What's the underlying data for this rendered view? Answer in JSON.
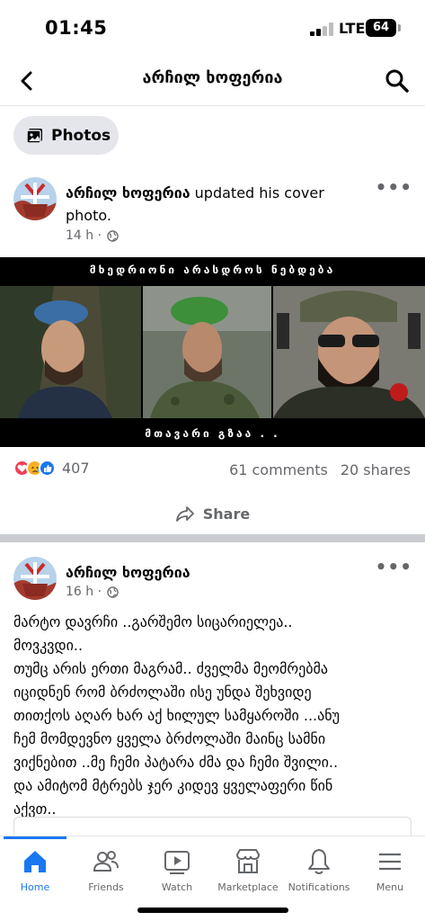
{
  "status_bar": {
    "time": "01:45",
    "network": "LTE",
    "battery": "64"
  },
  "header": {
    "title": "არჩილ ხოფერია"
  },
  "filter_chip": {
    "label": "Photos",
    "icon": "photos-icon"
  },
  "post1": {
    "author": "არჩილ ხოფერია",
    "action": " updated his cover photo.",
    "time": "14 h",
    "cover_image": {
      "top_text": "მხედრიონი არასდროს ნებდება",
      "bottom_text": "მთავარი გზაა . ."
    },
    "reactions": [
      "love",
      "sad",
      "like"
    ],
    "reaction_count": "407",
    "comments": "61 comments",
    "shares": "20 shares",
    "share_label": "Share"
  },
  "post2": {
    "author": "არჩილ ხოფერია",
    "time": "16 h",
    "text_lines": [
      "მარტო დავრჩი ..გარშემო სიცარიელეა..",
      "მოვკვდი..",
      "თუმც არის ერთი მაგრამ.. ძველმა მეომრებმა",
      "იციდნენ რომ ბრძოლაში ისე  უნდა შეხვიდე",
      "თითქოს აღარ ხარ აქ ხილულ სამყაროში ...ანუ",
      "ჩემ მომდევნო ყველა ბრძოლაში მაინც სამნი",
      "ვიქნებით ..მე ჩემი პატარა ძმა და ჩემი შვილი..",
      "და ამიტომ მტრებს ჯერ კიდევ ყველაფერი წინ",
      "აქვთ.."
    ]
  },
  "bottom_nav": [
    {
      "label": "Home",
      "icon": "home-icon",
      "active": true
    },
    {
      "label": "Friends",
      "icon": "friends-icon",
      "active": false
    },
    {
      "label": "Watch",
      "icon": "watch-icon",
      "active": false
    },
    {
      "label": "Marketplace",
      "icon": "marketplace-icon",
      "active": false
    },
    {
      "label": "Notifications",
      "icon": "bell-icon",
      "active": false
    },
    {
      "label": "Menu",
      "icon": "menu-icon",
      "active": false
    }
  ],
  "colors": {
    "accent": "#1877f2",
    "secondary_text": "#65676b",
    "divider": "#c9ccd1"
  }
}
